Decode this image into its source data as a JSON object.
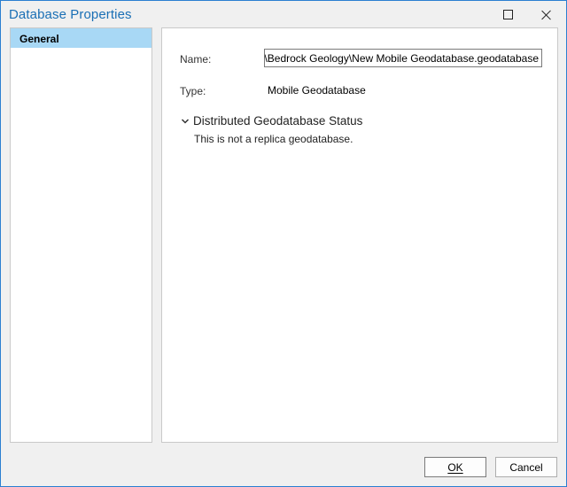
{
  "window": {
    "title": "Database Properties",
    "maximize_icon": "maximize-icon",
    "close_icon": "close-icon",
    "accent_color": "#1a6fb5"
  },
  "sidebar": {
    "items": [
      {
        "label": "General",
        "selected": true,
        "highlight_color": "#a8d8f5"
      }
    ]
  },
  "general": {
    "name_label": "Name:",
    "name_value": "p\\Bedrock Geology\\New Mobile Geodatabase.geodatabase",
    "type_label": "Type:",
    "type_value": "Mobile Geodatabase",
    "section": {
      "icon": "chevron-down-icon",
      "title": "Distributed Geodatabase Status",
      "expanded": true,
      "text": "This is not a replica geodatabase."
    }
  },
  "footer": {
    "ok_label": "OK",
    "cancel_label": "Cancel"
  }
}
